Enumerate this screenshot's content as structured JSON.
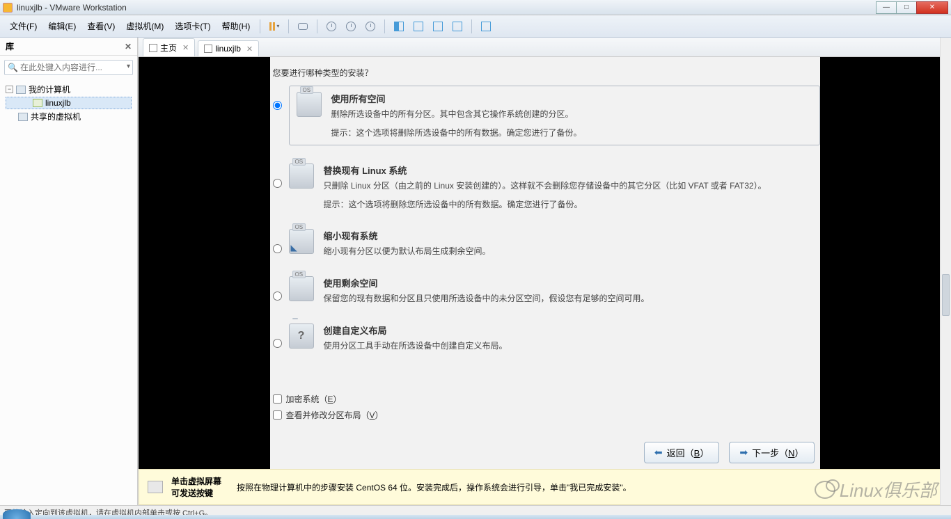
{
  "titlebar": {
    "text": "linuxjlb - VMware Workstation"
  },
  "menu": {
    "file": "文件(F)",
    "edit": "编辑(E)",
    "view": "查看(V)",
    "vm": "虚拟机(M)",
    "tabs": "选项卡(T)",
    "help": "帮助(H)"
  },
  "sidebar": {
    "title": "库",
    "search_placeholder": "在此处键入内容进行...",
    "tree": {
      "root": "我的计算机",
      "vm1": "linuxjlb",
      "shared": "共享的虚拟机"
    }
  },
  "tabs": {
    "home": "主页",
    "vm": "linuxjlb"
  },
  "installer": {
    "prompt": "您要进行哪种类型的安装？",
    "options": [
      {
        "title": "使用所有空间",
        "desc": "删除所选设备中的所有分区。其中包含其它操作系统创建的分区。",
        "hint": "提示：这个选项将删除所选设备中的所有数据。确定您进行了备份。",
        "selected": true,
        "icon": "os"
      },
      {
        "title": "替换现有 Linux 系统",
        "desc": "只删除 Linux 分区（由之前的 Linux 安装创建的）。这样就不会删除您存储设备中的其它分区（比如 VFAT 或者 FAT32）。",
        "hint": "提示：这个选项将删除您所选设备中的所有数据。确定您进行了备份。",
        "selected": false,
        "icon": "os"
      },
      {
        "title": "缩小现有系统",
        "desc": "缩小现有分区以便为默认布局生成剩余空间。",
        "hint": "",
        "selected": false,
        "icon": "shrink"
      },
      {
        "title": "使用剩余空间",
        "desc": "保留您的现有数据和分区且只使用所选设备中的未分区空间，假设您有足够的空间可用。",
        "hint": "",
        "selected": false,
        "icon": "os"
      },
      {
        "title": "创建自定义布局",
        "desc": "使用分区工具手动在所选设备中创建自定义布局。",
        "hint": "",
        "selected": false,
        "icon": "custom"
      }
    ],
    "checks": {
      "encrypt_pre": "加密系统（",
      "encrypt_u": "E",
      "encrypt_post": "）",
      "review_pre": "查看并修改分区布局（",
      "review_u": "V",
      "review_post": "）"
    },
    "nav": {
      "back_pre": "返回（",
      "back_u": "B",
      "back_post": "）",
      "next_pre": "下一步（",
      "next_u": "N",
      "next_post": "）"
    }
  },
  "hintbar": {
    "title1": "单击虚拟屏幕",
    "title2": "可发送按键",
    "body": "按照在物理计算机中的步骤安装 CentOS 64 位。安装完成后，操作系统会进行引导，单击\"我已完成安装\"。"
  },
  "statusbar": {
    "text": "要将输入定向到该虚拟机，请在虚拟机内部单击或按 Ctrl+G。"
  },
  "watermark": "Linux俱乐部"
}
